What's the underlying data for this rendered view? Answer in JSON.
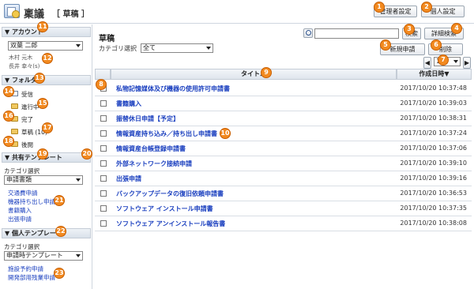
{
  "header": {
    "app_title": "稟議",
    "app_subtitle": "［ 草稿 ］",
    "admin_button": "管理者設定",
    "personal_button": "個人設定"
  },
  "toolbar": {
    "search_button": "検索",
    "advanced_search_button": "詳細検索",
    "new_button": "新規申請",
    "delete_button": "削除",
    "page_select": "1/1"
  },
  "main": {
    "heading": "草稿",
    "category_label": "カテゴリ選択",
    "category_value": "全て",
    "columns": {
      "title": "タイトル",
      "created": "作成日時▼"
    },
    "rows": [
      {
        "title": "私物記憶媒体及び機器の使用許可申請書",
        "created": "2017/10/20 10:37:48"
      },
      {
        "title": "書籍購入",
        "created": "2017/10/20 10:39:03"
      },
      {
        "title": "振替休日申請【予定】",
        "created": "2017/10/20 10:38:31"
      },
      {
        "title": "情報資産持ち込み／持ち出し申請書",
        "created": "2017/10/20 10:37:24"
      },
      {
        "title": "情報資産台帳登録申請書",
        "created": "2017/10/20 10:37:06"
      },
      {
        "title": "外部ネットワーク接続申請",
        "created": "2017/10/20 10:39:10"
      },
      {
        "title": "出張申請",
        "created": "2017/10/20 10:39:16"
      },
      {
        "title": "バックアップデータの復旧依頼申請書",
        "created": "2017/10/20 10:36:53"
      },
      {
        "title": "ソフトウェア インストール申請書",
        "created": "2017/10/20 10:37:35"
      },
      {
        "title": "ソフトウェア アンインストール報告書",
        "created": "2017/10/20 10:38:08"
      }
    ]
  },
  "sidebar": {
    "account": {
      "header": "▼ アカウント",
      "selected": "双葉 二郎",
      "delegates": [
        "木村 元木",
        "長井 幸々(s)"
      ]
    },
    "folders": {
      "header": "▼ フォルダ",
      "items": [
        "受信",
        "進行中",
        "完了",
        "草稿 (10)",
        "後閲"
      ]
    },
    "shared_templates": {
      "header": "▼ 共有テンプレート",
      "category_label": "カテゴリ選択",
      "category_value": "申請書類",
      "items": [
        "交通費申請",
        "機器持ち出し申請",
        "書籍購入",
        "出張申請"
      ]
    },
    "personal_templates": {
      "header": "▼ 個人テンプレート",
      "category_label": "カテゴリ選択",
      "category_value": "申請時テンプレート",
      "items": [
        "施設予約申請",
        "開発部用残業申請"
      ]
    }
  },
  "callouts": [
    "1",
    "2",
    "3",
    "4",
    "5",
    "6",
    "7",
    "8",
    "9",
    "10",
    "11",
    "12",
    "13",
    "14",
    "15",
    "16",
    "17",
    "18",
    "19",
    "20",
    "21",
    "22",
    "23"
  ],
  "colors": {
    "link": "#1a3fbf",
    "callout": "#f28a20"
  }
}
